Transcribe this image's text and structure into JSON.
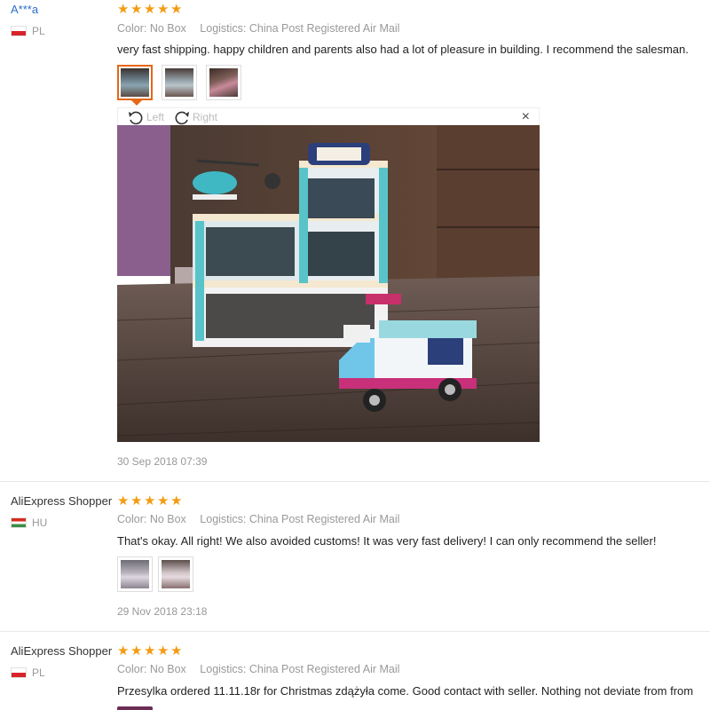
{
  "reviews": [
    {
      "user": "A***a",
      "country": "PL",
      "stars": 5,
      "color": "Color: No Box",
      "logistics": "Logistics: China Post Registered Air Mail",
      "text": "very fast shipping. happy children and parents also had a lot of pleasure in building. I recommend the salesman.",
      "date": "30 Sep 2018 07:39",
      "photo_count": 3
    },
    {
      "user": "AliExpress Shopper",
      "country": "HU",
      "stars": 5,
      "color": "Color: No Box",
      "logistics": "Logistics: China Post Registered Air Mail",
      "text": "That's okay. All right! We also avoided customs! It was very fast delivery! I can only recommend the seller!",
      "date": "29 Nov 2018 23:18",
      "photo_count": 2
    },
    {
      "user": "AliExpress Shopper",
      "country": "PL",
      "stars": 5,
      "color": "Color: No Box",
      "logistics": "Logistics: China Post Registered Air Mail",
      "text": "Przesylka ordered 11.11.18r for Christmas zdążyła come. Good contact with seller. Nothing not deviate from from",
      "date": ""
    }
  ],
  "viewer": {
    "rotate_left": "Left",
    "rotate_right": "Right",
    "close": "×"
  },
  "colors": {
    "star": "#f39c12",
    "accent": "#e56717",
    "link": "#2d6fc9"
  },
  "icons": {
    "rotate_left": "rotate-left-icon",
    "rotate_right": "rotate-right-icon",
    "close": "close-icon",
    "star": "star-icon"
  }
}
